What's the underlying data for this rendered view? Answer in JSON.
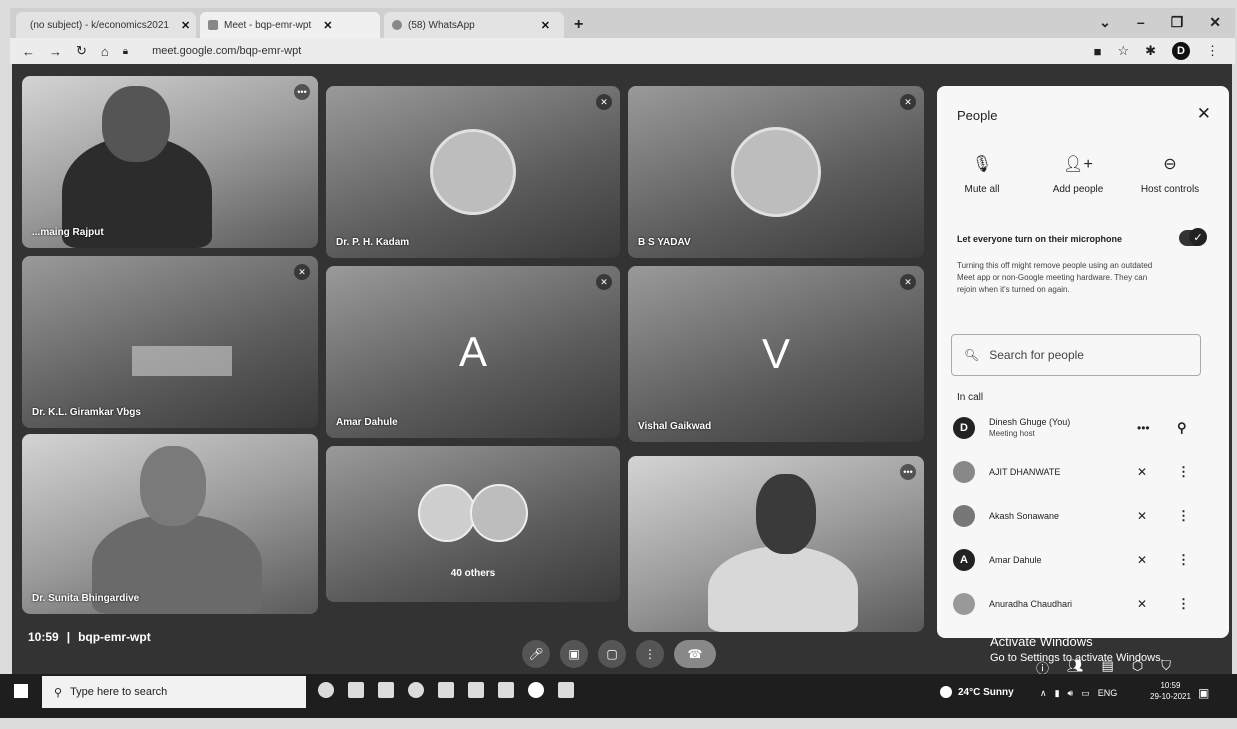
{
  "browser": {
    "tabs": [
      {
        "label": "(no subject) - k/economics2021",
        "close": "✕"
      },
      {
        "label": "Meet - bqp-emr-wpt",
        "close": "✕"
      },
      {
        "label": "(58) WhatsApp",
        "close": "✕"
      }
    ],
    "new_tab": "+",
    "url": "meet.google.com/bqp-emr-wpt",
    "profile_initial": "D"
  },
  "tiles": [
    {
      "name": "...maing Rajput"
    },
    {
      "name": "Dr. P. H. Kadam"
    },
    {
      "name": "B S YADAV"
    },
    {
      "name": "Dr. K.L. Giramkar Vbgs"
    },
    {
      "name": "Amar Dahule",
      "letter": "A"
    },
    {
      "name": "Vishal Gaikwad",
      "letter": "V"
    },
    {
      "name": "Dr. Sunita Bhingardive"
    },
    {
      "name": "40 others"
    },
    {
      "name": ""
    }
  ],
  "meeting": {
    "time": "10:59",
    "separator": "|",
    "code": "bqp-emr-wpt"
  },
  "people_panel": {
    "title": "People",
    "actions": {
      "mute_all": "Mute all",
      "add_people": "Add people",
      "host_controls": "Host controls"
    },
    "mic_toggle_label": "Let everyone turn on their microphone",
    "mic_description": "Turning this off might remove people using an outdated Meet app or non-Google meeting hardware. They can rejoin when it's turned on again.",
    "search_placeholder": "Search for people",
    "section_label": "In call",
    "participants": [
      {
        "initial": "D",
        "name": "Dinesh Ghuge (You)",
        "sub": "Meeting host"
      },
      {
        "initial": "",
        "name": "AJIT DHANWATE",
        "sub": ""
      },
      {
        "initial": "",
        "name": "Akash Sonawane",
        "sub": ""
      },
      {
        "initial": "A",
        "name": "Amar Dahule",
        "sub": ""
      },
      {
        "initial": "",
        "name": "Anuradha Chaudhari",
        "sub": ""
      }
    ]
  },
  "watermark": {
    "line1": "Activate Windows",
    "line2": "Go to Settings to activate Windows."
  },
  "taskbar": {
    "search_placeholder": "Type here to search",
    "weather": "24°C  Sunny",
    "language": "ENG",
    "time": "10:59",
    "date": "29-10-2021"
  }
}
